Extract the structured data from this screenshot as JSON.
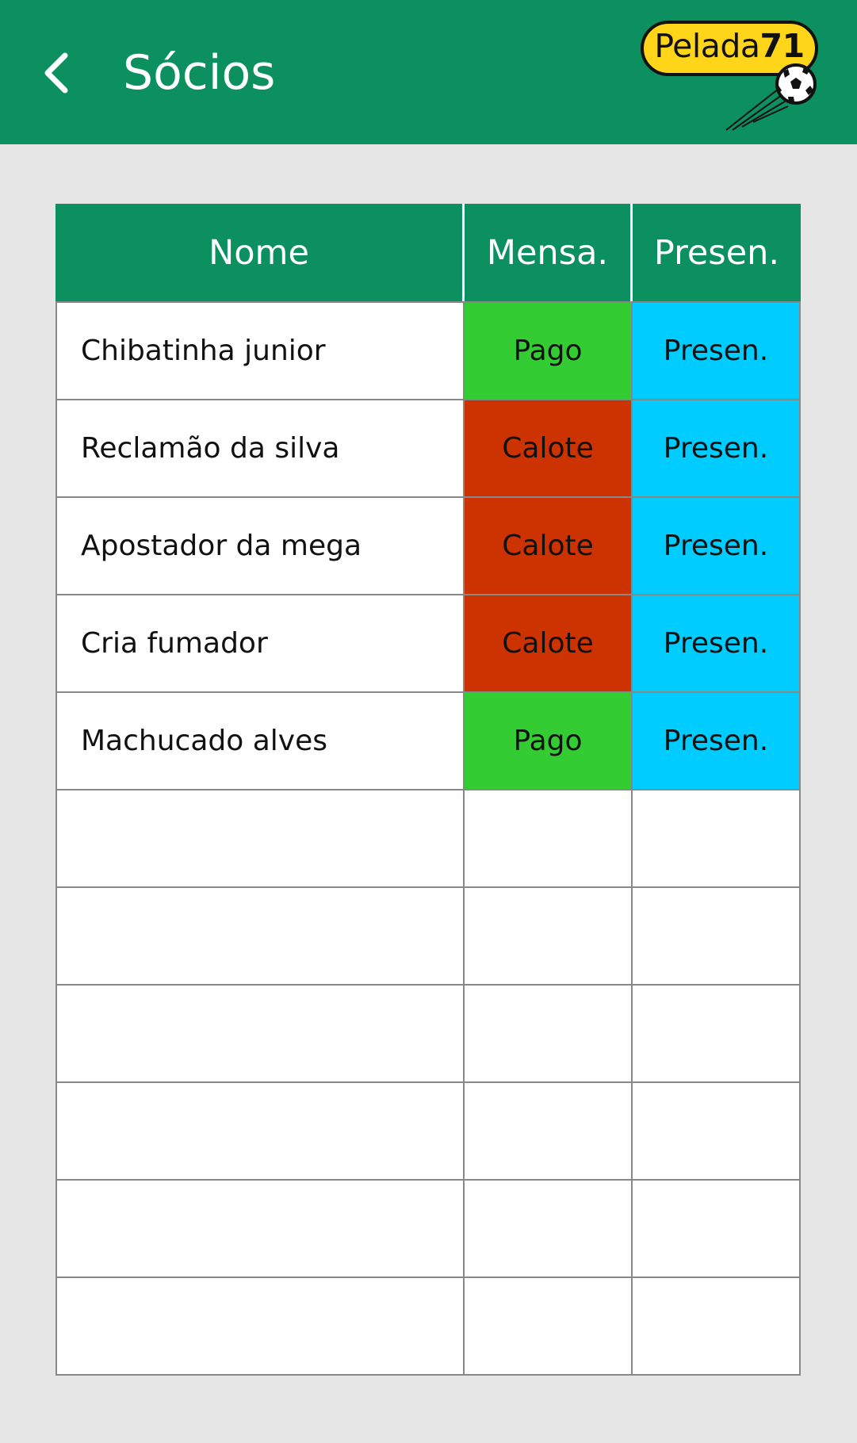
{
  "header": {
    "title": "Sócios",
    "logo_text": "Pelada",
    "logo_number": "71",
    "color": "#0c9060"
  },
  "table": {
    "columns": [
      "Nome",
      "Mensa.",
      "Presen."
    ],
    "rows": [
      {
        "name": "Chibatinha junior",
        "mensalidade": "Pago",
        "presenca": "Presen."
      },
      {
        "name": "Reclamão da silva",
        "mensalidade": "Calote",
        "presenca": "Presen."
      },
      {
        "name": "Apostador da mega",
        "mensalidade": "Calote",
        "presenca": "Presen."
      },
      {
        "name": "Cria fumador",
        "mensalidade": "Calote",
        "presenca": "Presen."
      },
      {
        "name": "Machucado alves",
        "mensalidade": "Pago",
        "presenca": "Presen."
      }
    ],
    "empty_rows": 6
  },
  "colors": {
    "pago": "#33cc33",
    "calote": "#cc3300",
    "presen": "#00ccff",
    "logo": "#ffd51a"
  },
  "icons": {
    "back": "chevron-left-icon",
    "ball": "soccer-ball-icon"
  }
}
